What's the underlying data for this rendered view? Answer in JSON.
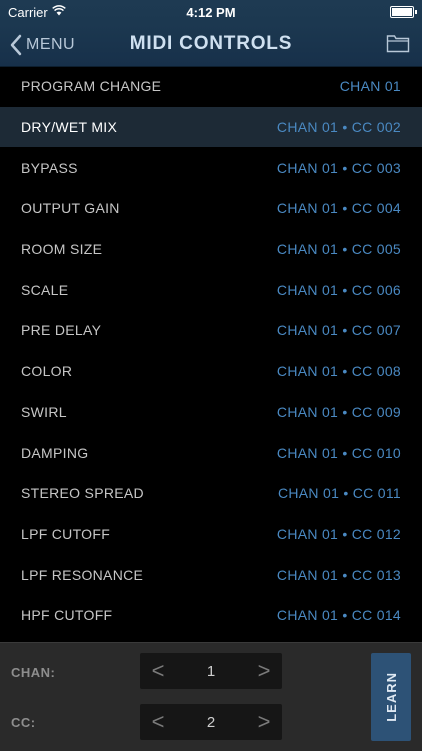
{
  "status_bar": {
    "carrier": "Carrier",
    "time": "4:12 PM"
  },
  "nav": {
    "back_label": "MENU",
    "title": "MIDI CONTROLS",
    "back_icon": "chevron-left-icon",
    "right_icon": "folder-icon"
  },
  "list": {
    "selected_index": 1,
    "rows": [
      {
        "name": "PROGRAM CHANGE",
        "assignment": "CHAN 01"
      },
      {
        "name": "DRY/WET MIX",
        "assignment": "CHAN 01 • CC 002"
      },
      {
        "name": "BYPASS",
        "assignment": "CHAN 01 • CC 003"
      },
      {
        "name": "OUTPUT GAIN",
        "assignment": "CHAN 01 • CC 004"
      },
      {
        "name": "ROOM SIZE",
        "assignment": "CHAN 01 • CC 005"
      },
      {
        "name": "SCALE",
        "assignment": "CHAN 01 • CC 006"
      },
      {
        "name": "PRE DELAY",
        "assignment": "CHAN 01 • CC 007"
      },
      {
        "name": "COLOR",
        "assignment": "CHAN 01 • CC 008"
      },
      {
        "name": "SWIRL",
        "assignment": "CHAN 01 • CC 009"
      },
      {
        "name": "DAMPING",
        "assignment": "CHAN 01 • CC 010"
      },
      {
        "name": "STEREO SPREAD",
        "assignment": "CHAN 01 • CC 011"
      },
      {
        "name": "LPF CUTOFF",
        "assignment": "CHAN 01 • CC 012"
      },
      {
        "name": "LPF RESONANCE",
        "assignment": "CHAN 01 • CC 013"
      },
      {
        "name": "HPF CUTOFF",
        "assignment": "CHAN 01 • CC 014"
      }
    ]
  },
  "controls": {
    "chan_label": "CHAN:",
    "chan_value": "1",
    "cc_label": "CC:",
    "cc_value": "2",
    "decrement": "<",
    "increment": ">",
    "learn_label": "LEARN"
  },
  "colors": {
    "accent": "#4a89c2",
    "nav_bg": "#1c3850",
    "learn_bg": "#2d5276",
    "selected_row": "#1d2a36"
  }
}
